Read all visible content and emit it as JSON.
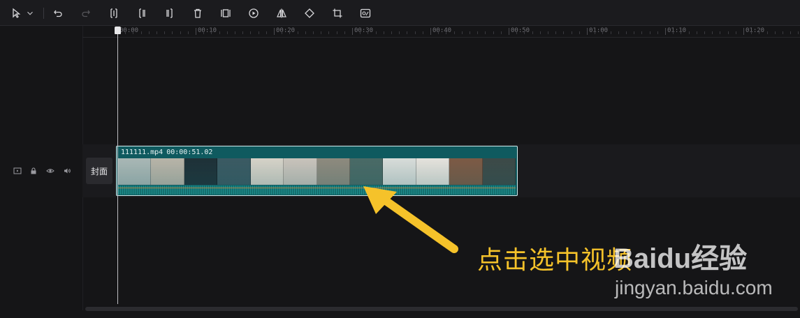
{
  "toolbar": {
    "tools": [
      "select-arrow",
      "dropdown-chevron",
      "undo",
      "redo",
      "split",
      "split-left",
      "split-right",
      "delete",
      "freeze-frame",
      "reverse",
      "mirror",
      "rotate",
      "crop",
      "smart-cutout"
    ]
  },
  "ruler": {
    "labels": [
      "00:00",
      "00:10",
      "00:20",
      "00:30",
      "00:40",
      "00:50",
      "01:00",
      "01:10",
      "01:20"
    ]
  },
  "track": {
    "controls": [
      "video-track-icon",
      "lock-icon",
      "eye-icon",
      "volume-icon"
    ],
    "cover_label": "封面"
  },
  "clip": {
    "name": "111111.mp4",
    "duration": "00:00:51.02",
    "thumb_colors": [
      "#a9b7b5",
      "#b8b4a8",
      "#1f3138",
      "#3b5a63",
      "#d6d2c8",
      "#c9c3bb",
      "#8e8a7e",
      "#4a6a66",
      "#d8dcd9",
      "#e5e2dc",
      "#7d5a45",
      "#3d4a48"
    ]
  },
  "annotation": {
    "text": "点击选中视频",
    "color": "#f5c22a"
  },
  "watermark": {
    "logo": "Baidu经验",
    "url": "jingyan.baidu.com"
  }
}
